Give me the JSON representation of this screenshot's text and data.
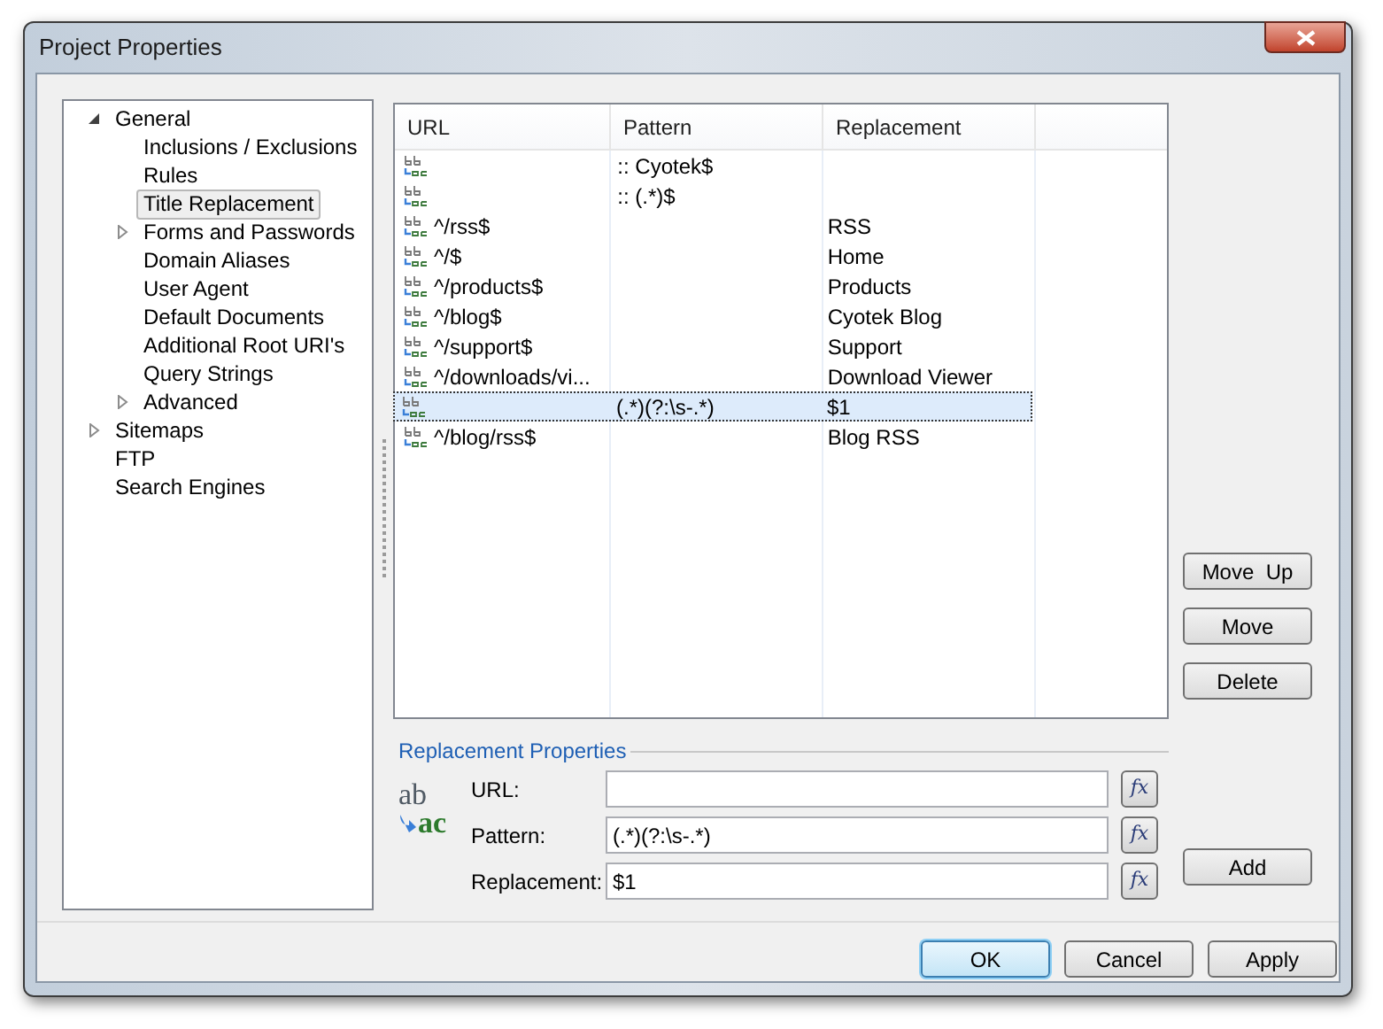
{
  "window": {
    "title": "Project Properties"
  },
  "tree": [
    {
      "label": "General",
      "expanded": true,
      "selected": false,
      "children": [
        {
          "label": "Inclusions / Exclusions",
          "selected": false
        },
        {
          "label": "Rules",
          "selected": false
        },
        {
          "label": "Title Replacement",
          "selected": true
        },
        {
          "label": "Forms and Passwords",
          "expanded": false,
          "selected": false
        },
        {
          "label": "Domain Aliases",
          "selected": false
        },
        {
          "label": "User Agent",
          "selected": false
        },
        {
          "label": "Default Documents",
          "selected": false
        },
        {
          "label": "Additional Root URI's",
          "selected": false
        },
        {
          "label": "Query Strings",
          "selected": false
        },
        {
          "label": "Advanced",
          "expanded": false,
          "selected": false
        }
      ]
    },
    {
      "label": "Sitemaps",
      "expanded": false,
      "selected": false
    },
    {
      "label": "FTP",
      "selected": false
    },
    {
      "label": "Search Engines",
      "selected": false
    }
  ],
  "table": {
    "columns": [
      "URL",
      "Pattern",
      "Replacement"
    ],
    "rows": [
      {
        "pattern": ":: Cyotek$",
        "selected": false
      },
      {
        "pattern": ":: (.*)$",
        "selected": false
      },
      {
        "url": "^/rss$",
        "replacement": "RSS",
        "selected": false
      },
      {
        "url": "^/$",
        "replacement": "Home",
        "selected": false
      },
      {
        "url": "^/products$",
        "replacement": "Products",
        "selected": false
      },
      {
        "url": "^/blog$",
        "replacement": "Cyotek Blog",
        "selected": false
      },
      {
        "url": "^/support$",
        "replacement": "Support",
        "selected": false
      },
      {
        "url": "^/downloads/vi...",
        "replacement": "Download Viewer",
        "selected": false
      },
      {
        "pattern": "(.*)(?:\\s-.*)",
        "replacement": "$1",
        "selected": true
      },
      {
        "url": "^/blog/rss$",
        "replacement": "Blog RSS",
        "selected": false
      }
    ]
  },
  "side_buttons": [
    "Move  Up",
    "Move",
    "Delete"
  ],
  "properties": {
    "title": "Replacement Properties",
    "icon_top": "ab",
    "icon_bottom": "ac",
    "fields": [
      {
        "label": "URL:",
        "formula_button": "fx"
      },
      {
        "label": "Pattern:",
        "value": "(.*)(?:\\s-.*)",
        "formula_button": "fx"
      },
      {
        "label": "Replacement:",
        "value": "$1",
        "formula_button": "fx"
      }
    ]
  },
  "add_button": "Add",
  "buttons": [
    {
      "label": "OK",
      "default": true
    },
    {
      "label": "Cancel",
      "default": false
    },
    {
      "label": "Apply",
      "default": false
    }
  ]
}
